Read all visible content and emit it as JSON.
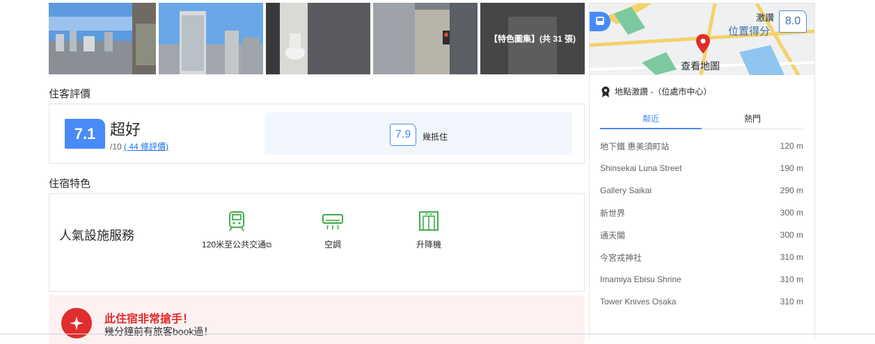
{
  "gallery": {
    "more_label": "【特色圖集】(共 31 張)",
    "photos": [
      "balcony-city-view",
      "hotel-exterior",
      "bathroom",
      "street-view",
      "room-interior"
    ]
  },
  "reviews": {
    "section_title": "住客評價",
    "score": "7.1",
    "word": "超好",
    "out_of": "/10",
    "count_link": "( 44 條評價)",
    "sub_score": "7.9",
    "sub_label": "幾抵住"
  },
  "features": {
    "section_title": "住宿特色",
    "heading": "人氣設施服務",
    "items": [
      {
        "label": "120米至公共交通",
        "icon": "train-icon"
      },
      {
        "label": "空調",
        "icon": "air-conditioner-icon"
      },
      {
        "label": "升降機",
        "icon": "elevator-icon"
      }
    ]
  },
  "promo": {
    "title": "此住宿非常搶手！",
    "subtitle": "幾分鐘前有旅客book過！"
  },
  "map": {
    "rating_word": "激讚",
    "rating_label": "位置得分",
    "rating_score": "8.0",
    "view_map": "查看地圖"
  },
  "location": {
    "heading": "地點激讚 -（位處市中心）",
    "tabs": [
      "鄰近",
      "熱門"
    ],
    "active_tab": 0,
    "places": [
      {
        "name": "地下鐵 惠美須町站",
        "distance": "120 m"
      },
      {
        "name": "Shinsekai Luna Street",
        "distance": "190 m"
      },
      {
        "name": "Gallery Saikai",
        "distance": "290 m"
      },
      {
        "name": "新世界",
        "distance": "300 m"
      },
      {
        "name": "通天閣",
        "distance": "300 m"
      },
      {
        "name": "今宮戎神社",
        "distance": "310 m"
      },
      {
        "name": "Imamiya Ebisu Shrine",
        "distance": "310 m"
      },
      {
        "name": "Tower Knives Osaka",
        "distance": "310 m"
      }
    ]
  },
  "colors": {
    "accent": "#488bf8",
    "promo_red": "#e12d2d",
    "feature_green": "#3fae49"
  }
}
